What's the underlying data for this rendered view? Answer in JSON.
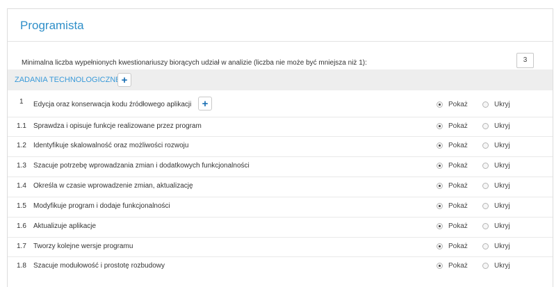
{
  "title": "Programista",
  "min_label": "Minimalna liczba wypełnionych kwestionariuszy biorących udział w analizie (liczba nie może być mniejsza niż 1):",
  "min_value": "3",
  "section_title": "ZADANIA TECHNOLOGICZNE",
  "plus_icon": "+",
  "show_label": "Pokaż",
  "hide_label": "Ukryj",
  "items": [
    {
      "num": "1",
      "text": "Edycja oraz konserwacja kodu źródłowego aplikacji",
      "selected": "show"
    },
    {
      "num": "1.1",
      "text": "Sprawdza i opisuje funkcje realizowane przez program",
      "selected": "show"
    },
    {
      "num": "1.2",
      "text": "Identyfikuje skalowalność oraz możliwości rozwoju",
      "selected": "show"
    },
    {
      "num": "1.3",
      "text": "Szacuje potrzebę wprowadzania zmian i dodatkowych funkcjonalności",
      "selected": "show"
    },
    {
      "num": "1.4",
      "text": "Określa w czasie wprowadzenie zmian, aktualizację",
      "selected": "show"
    },
    {
      "num": "1.5",
      "text": "Modyfikuje program i dodaje funkcjonalności",
      "selected": "show"
    },
    {
      "num": "1.6",
      "text": "Aktualizuje aplikacje",
      "selected": "show"
    },
    {
      "num": "1.7",
      "text": "Tworzy kolejne wersje programu",
      "selected": "show"
    },
    {
      "num": "1.8",
      "text": "Szacuje modułowość i prostotę rozbudowy",
      "selected": "show"
    }
  ]
}
